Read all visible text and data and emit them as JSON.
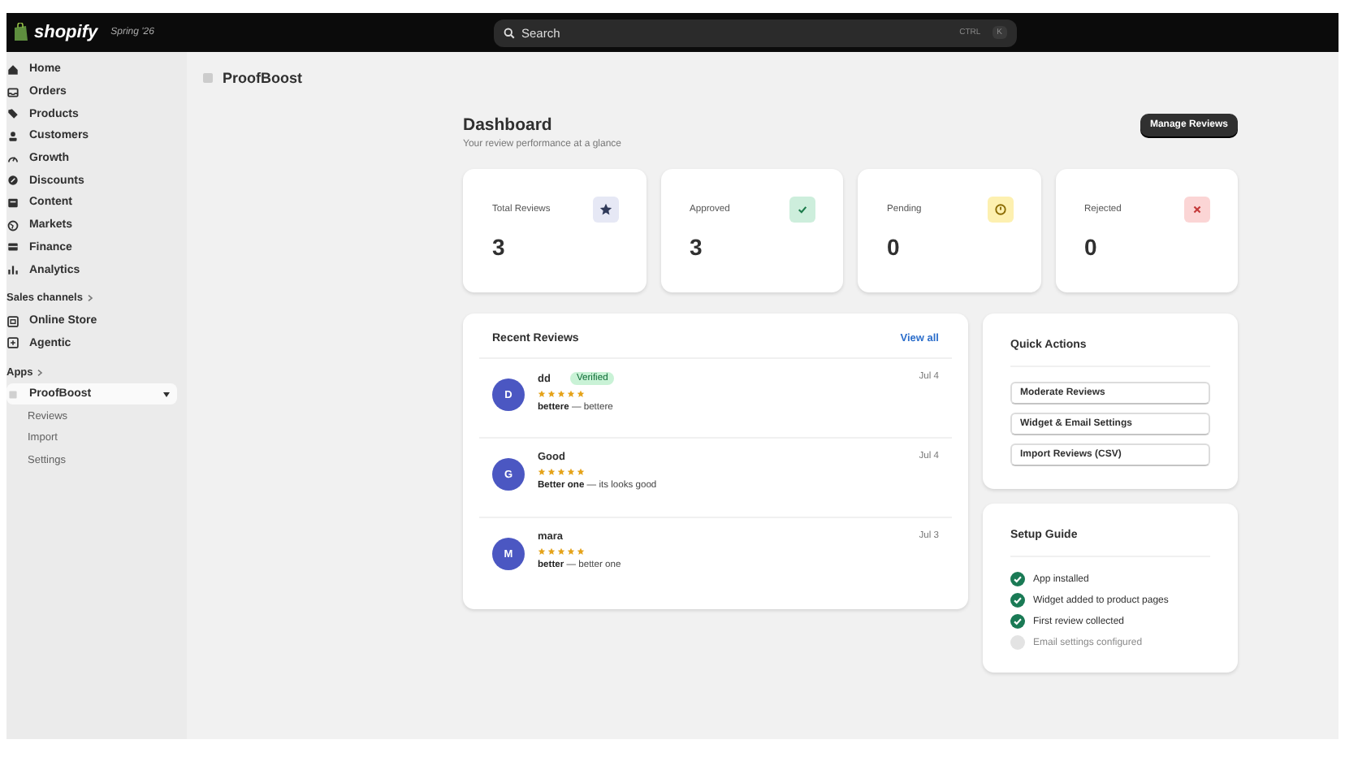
{
  "topbar": {
    "brand": "shopify",
    "edition": "Spring '26",
    "search": {
      "placeholder": "Search"
    },
    "shortcut": [
      "CTRL",
      "K"
    ]
  },
  "sidebar": {
    "items": [
      {
        "label": "Home",
        "kind": "home"
      },
      {
        "label": "Orders",
        "kind": "inbox"
      },
      {
        "label": "Products",
        "kind": "tag"
      },
      {
        "label": "Customers",
        "kind": "person"
      },
      {
        "label": "Growth",
        "kind": "gauge"
      },
      {
        "label": "Discounts",
        "kind": "discount"
      },
      {
        "label": "Content",
        "kind": "content"
      },
      {
        "label": "Markets",
        "kind": "globe"
      },
      {
        "label": "Finance",
        "kind": "bank"
      },
      {
        "label": "Analytics",
        "kind": "chart"
      }
    ],
    "sections": [
      {
        "title": "Sales channels",
        "items": [
          {
            "label": "Online Store",
            "kind": "store"
          },
          {
            "label": "Agentic",
            "kind": "plus"
          }
        ]
      },
      {
        "title": "Apps",
        "items": [
          {
            "label": "ProofBoost",
            "kind": "app",
            "expanded": true,
            "children": [
              "Reviews",
              "Import",
              "Settings"
            ]
          }
        ]
      }
    ]
  },
  "page_title": "ProofBoost",
  "dashboard": {
    "title": "Dashboard",
    "subtitle": "Your review performance at a glance",
    "button": "Manage Reviews"
  },
  "stats": [
    {
      "label": "Total Reviews",
      "value": "3",
      "kind": "total"
    },
    {
      "label": "Approved",
      "value": "3",
      "kind": "approved"
    },
    {
      "label": "Pending",
      "value": "0",
      "kind": "pending"
    },
    {
      "label": "Rejected",
      "value": "0",
      "kind": "rejected"
    }
  ],
  "recent_reviews": {
    "title": "Recent Reviews",
    "link": "View all",
    "reviews": [
      {
        "initial": "D",
        "name": "dd",
        "badge": "Verified",
        "stars": 5,
        "text": "**bettere** — bettere",
        "date": "Jul 4"
      },
      {
        "initial": "G",
        "name": "Good",
        "stars": 5,
        "text": "**Better one** — its looks good",
        "date": "Jul 4"
      },
      {
        "initial": "M",
        "name": "mara",
        "stars": 5,
        "text": "**better** — better one",
        "date": "Jul 3"
      }
    ]
  },
  "quick_actions": {
    "title": "Quick Actions",
    "buttons": [
      "Moderate Reviews",
      "Widget & Email Settings",
      "Import Reviews (CSV)"
    ]
  },
  "setup_guide": {
    "title": "Setup Guide",
    "steps": [
      {
        "label": "App installed",
        "done": true
      },
      {
        "label": "Widget added to product pages",
        "done": true
      },
      {
        "label": "First review collected",
        "done": true
      },
      {
        "label": "Email settings configured",
        "done": false
      }
    ]
  }
}
